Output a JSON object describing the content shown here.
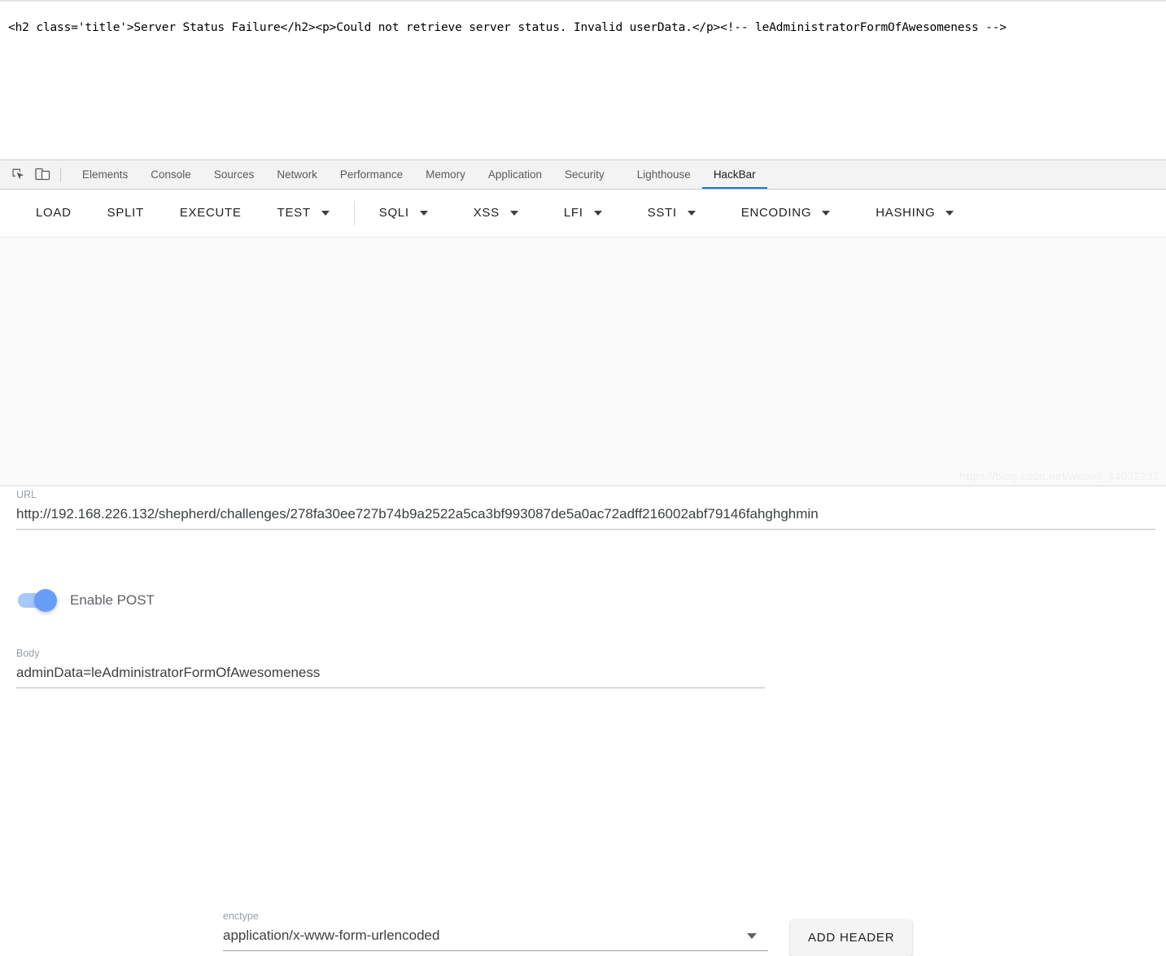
{
  "page_view": {
    "source_line": "<h2 class='title'>Server Status Failure</h2><p>Could not retrieve server status. Invalid userData.</p><!-- leAdministratorFormOfAwesomeness -->"
  },
  "devtools": {
    "icons": {
      "inspect": "inspect-element-icon",
      "device": "device-toolbar-icon"
    },
    "tabs": [
      {
        "label": "Elements",
        "active": false
      },
      {
        "label": "Console",
        "active": false
      },
      {
        "label": "Sources",
        "active": false
      },
      {
        "label": "Network",
        "active": false
      },
      {
        "label": "Performance",
        "active": false
      },
      {
        "label": "Memory",
        "active": false
      },
      {
        "label": "Application",
        "active": false
      },
      {
        "label": "Security",
        "active": false
      },
      {
        "label": "Lighthouse",
        "active": false
      },
      {
        "label": "HackBar",
        "active": true
      }
    ],
    "active_tab": "HackBar",
    "active_tab_color": "#1a73e8"
  },
  "hackbar": {
    "toolbar": [
      {
        "label": "LOAD",
        "has_caret": false
      },
      {
        "label": "SPLIT",
        "has_caret": false
      },
      {
        "label": "EXECUTE",
        "has_caret": false
      },
      {
        "label": "TEST",
        "has_caret": true
      },
      {
        "label": "SQLI",
        "has_caret": true
      },
      {
        "label": "XSS",
        "has_caret": true
      },
      {
        "label": "LFI",
        "has_caret": true
      },
      {
        "label": "SSTI",
        "has_caret": true
      },
      {
        "label": "ENCODING",
        "has_caret": true
      },
      {
        "label": "HASHING",
        "has_caret": true
      }
    ],
    "url": {
      "label": "URL",
      "value": "http://192.168.226.132/shepherd/challenges/278fa30ee727b74b9a2522a5ca3bf993087de5a0ac72adff216002abf79146fahghghmin"
    },
    "post": {
      "toggle_label": "Enable POST",
      "toggle_on": true,
      "toggle_color": "#669df6"
    },
    "enctype": {
      "label": "enctype",
      "value": "application/x-www-form-urlencoded"
    },
    "add_header_label": "ADD HEADER",
    "body": {
      "label": "Body",
      "value": "adminData=leAdministratorFormOfAwesomeness"
    }
  },
  "watermark": {
    "text": "https://blog.csdn.net/weixin_44032232"
  }
}
